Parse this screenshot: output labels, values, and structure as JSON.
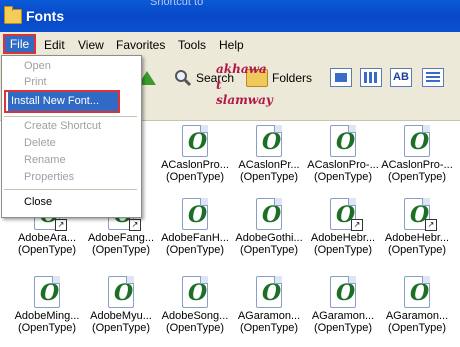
{
  "window": {
    "title": "Fonts",
    "background_ghost": "Shortcut to"
  },
  "menubar": [
    {
      "label": "File"
    },
    {
      "label": "Edit"
    },
    {
      "label": "View"
    },
    {
      "label": "Favorites"
    },
    {
      "label": "Tools"
    },
    {
      "label": "Help"
    }
  ],
  "toolbar": {
    "search_label": "Search",
    "folders_label": "Folders"
  },
  "file_menu": {
    "items": [
      {
        "label": "Open",
        "enabled": false
      },
      {
        "label": "Print",
        "enabled": false
      },
      {
        "label": "Install New Font...",
        "enabled": true,
        "highlighted": true
      },
      {
        "label": "Create Shortcut",
        "enabled": false
      },
      {
        "label": "Delete",
        "enabled": false
      },
      {
        "label": "Rename",
        "enabled": false
      },
      {
        "label": "Properties",
        "enabled": false
      },
      {
        "label": "Close",
        "enabled": true
      }
    ]
  },
  "watermark": "akhawa t slamway",
  "fonts": [
    {
      "name": "",
      "type": ""
    },
    {
      "name": "",
      "type": ""
    },
    {
      "name": "ACaslonPro...",
      "type": "(OpenType)"
    },
    {
      "name": "ACaslonPr...",
      "type": "(OpenType)"
    },
    {
      "name": "ACaslonPro-...",
      "type": "(OpenType)"
    },
    {
      "name": "ACaslonPro-...",
      "type": "(OpenType)"
    },
    {
      "name": "AdobeAra...",
      "type": "(OpenType)"
    },
    {
      "name": "AdobeFang...",
      "type": "(OpenType)"
    },
    {
      "name": "AdobeFanH...",
      "type": "(OpenType)"
    },
    {
      "name": "AdobeGothi...",
      "type": "(OpenType)"
    },
    {
      "name": "AdobeHebr...",
      "type": "(OpenType)"
    },
    {
      "name": "AdobeHebr...",
      "type": "(OpenType)"
    },
    {
      "name": "AdobeMing...",
      "type": "(OpenType)"
    },
    {
      "name": "AdobeMyu...",
      "type": "(OpenType)"
    },
    {
      "name": "AdobeSong...",
      "type": "(OpenType)"
    },
    {
      "name": "AGaramon...",
      "type": "(OpenType)"
    },
    {
      "name": "AGaramon...",
      "type": "(OpenType)"
    },
    {
      "name": "AGaramon...",
      "type": "(OpenType)"
    }
  ],
  "colors": {
    "title_bar": "#0a52d0",
    "highlight": "#316ac5",
    "callout": "#dd3333"
  }
}
